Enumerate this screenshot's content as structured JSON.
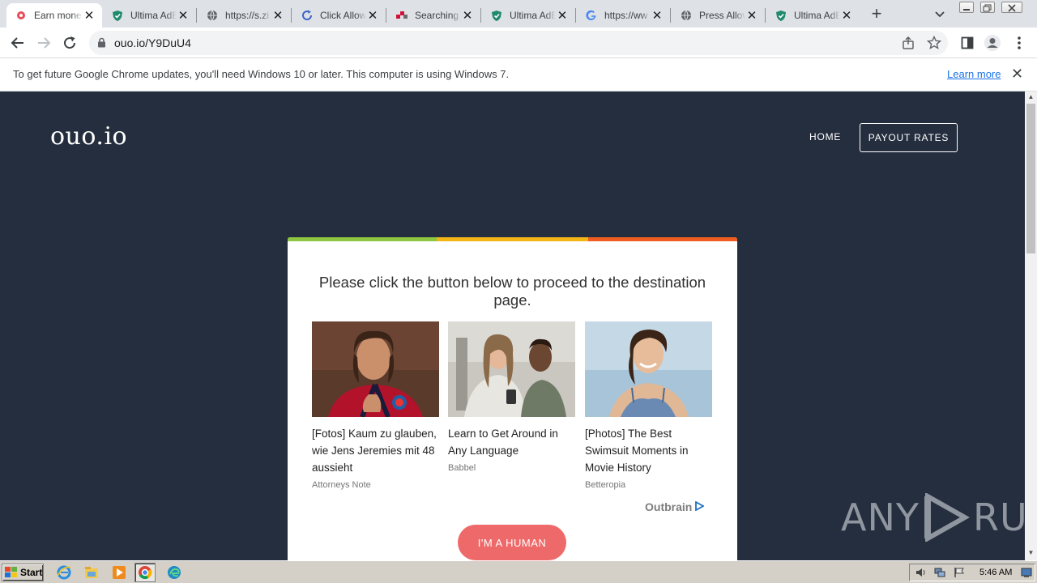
{
  "browser": {
    "tabs": [
      {
        "title": "Earn mone",
        "favicon": "ouo-icon",
        "active": true
      },
      {
        "title": "Ultima AdBl",
        "favicon": "shield-icon",
        "active": false
      },
      {
        "title": "https://s.zi",
        "favicon": "globe-icon",
        "active": false
      },
      {
        "title": "Click Allow",
        "favicon": "refresh-icon",
        "active": false
      },
      {
        "title": "Searching f",
        "favicon": "dots-icon",
        "active": false
      },
      {
        "title": "Ultima AdBl",
        "favicon": "shield-icon",
        "active": false
      },
      {
        "title": "https://ww",
        "favicon": "google-icon",
        "active": false
      },
      {
        "title": "Press Allow",
        "favicon": "globe-icon",
        "active": false
      },
      {
        "title": "Ultima AdBl",
        "favicon": "shield-icon",
        "active": false
      }
    ],
    "new_tab_label": "+",
    "tab_close_glyph": "✕",
    "url": "ouo.io/Y9DuU4",
    "infobar": {
      "message": "To get future Google Chrome updates, you'll need Windows 10 or later. This computer is using Windows 7.",
      "link": "Learn more",
      "close_glyph": "✕"
    }
  },
  "page": {
    "logo": "ouo.io",
    "nav": {
      "home": "HOME",
      "payout": "PAYOUT RATES"
    },
    "card": {
      "prompt": "Please click the button below to proceed to the destination page.",
      "stripe_colors": [
        "#8dc63f",
        "#f2b515",
        "#ef5d21"
      ],
      "recommendations": [
        {
          "headline": "[Fotos] Kaum zu glauben, wie Jens Jeremies mit 48 aussieht",
          "source": "Attorneys Note"
        },
        {
          "headline": "Learn to Get Around in Any Language",
          "source": "Babbel"
        },
        {
          "headline": "[Photos] The Best Swimsuit Moments in Movie History",
          "source": "Betteropia"
        }
      ],
      "outbrain_label": "Outbrain",
      "button": "I'M A HUMAN"
    },
    "watermark_left": "ANY",
    "watermark_right": "RUN"
  },
  "taskbar": {
    "start_label": "Start",
    "clock": "5:46 AM"
  },
  "colors": {
    "page_bg": "#252e3e",
    "button": "#ee6a6a",
    "link": "#1a73e8"
  }
}
